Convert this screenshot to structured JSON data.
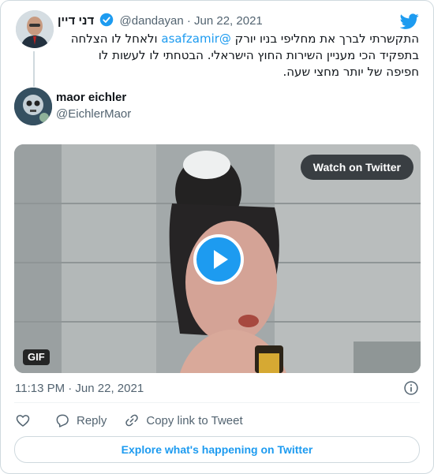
{
  "tweet": {
    "author_name": "דני דיין",
    "handle": "@dandayan",
    "separator": "·",
    "date": "Jun 22, 2021",
    "text_before": "התקשרתי לברך את מחליפי בניו יורק ",
    "mention": "@asafzamir",
    "text_after": " ולאחל לו הצלחה בתפקיד הכי מעניין השירות החוץ הישראלי. הבטחתי לו לעשות לו חפיפה של יותר מחצי שעה."
  },
  "quote": {
    "name": "maor eichler",
    "handle": "@EichlerMaor"
  },
  "media": {
    "watch_label": "Watch on Twitter",
    "gif_label": "GIF"
  },
  "footer": {
    "timestamp": "11:13 PM · Jun 22, 2021",
    "reply_label": "Reply",
    "copy_link_label": "Copy link to Tweet",
    "explore_label": "Explore what's happening on Twitter"
  },
  "colors": {
    "accent": "#1d9bf0",
    "text_primary": "#0f1419",
    "text_secondary": "#536471",
    "border": "#cfd9de"
  },
  "icons": [
    "twitter-bird-icon",
    "verified-badge-icon",
    "play-icon",
    "info-icon",
    "heart-icon",
    "reply-icon",
    "link-icon"
  ]
}
